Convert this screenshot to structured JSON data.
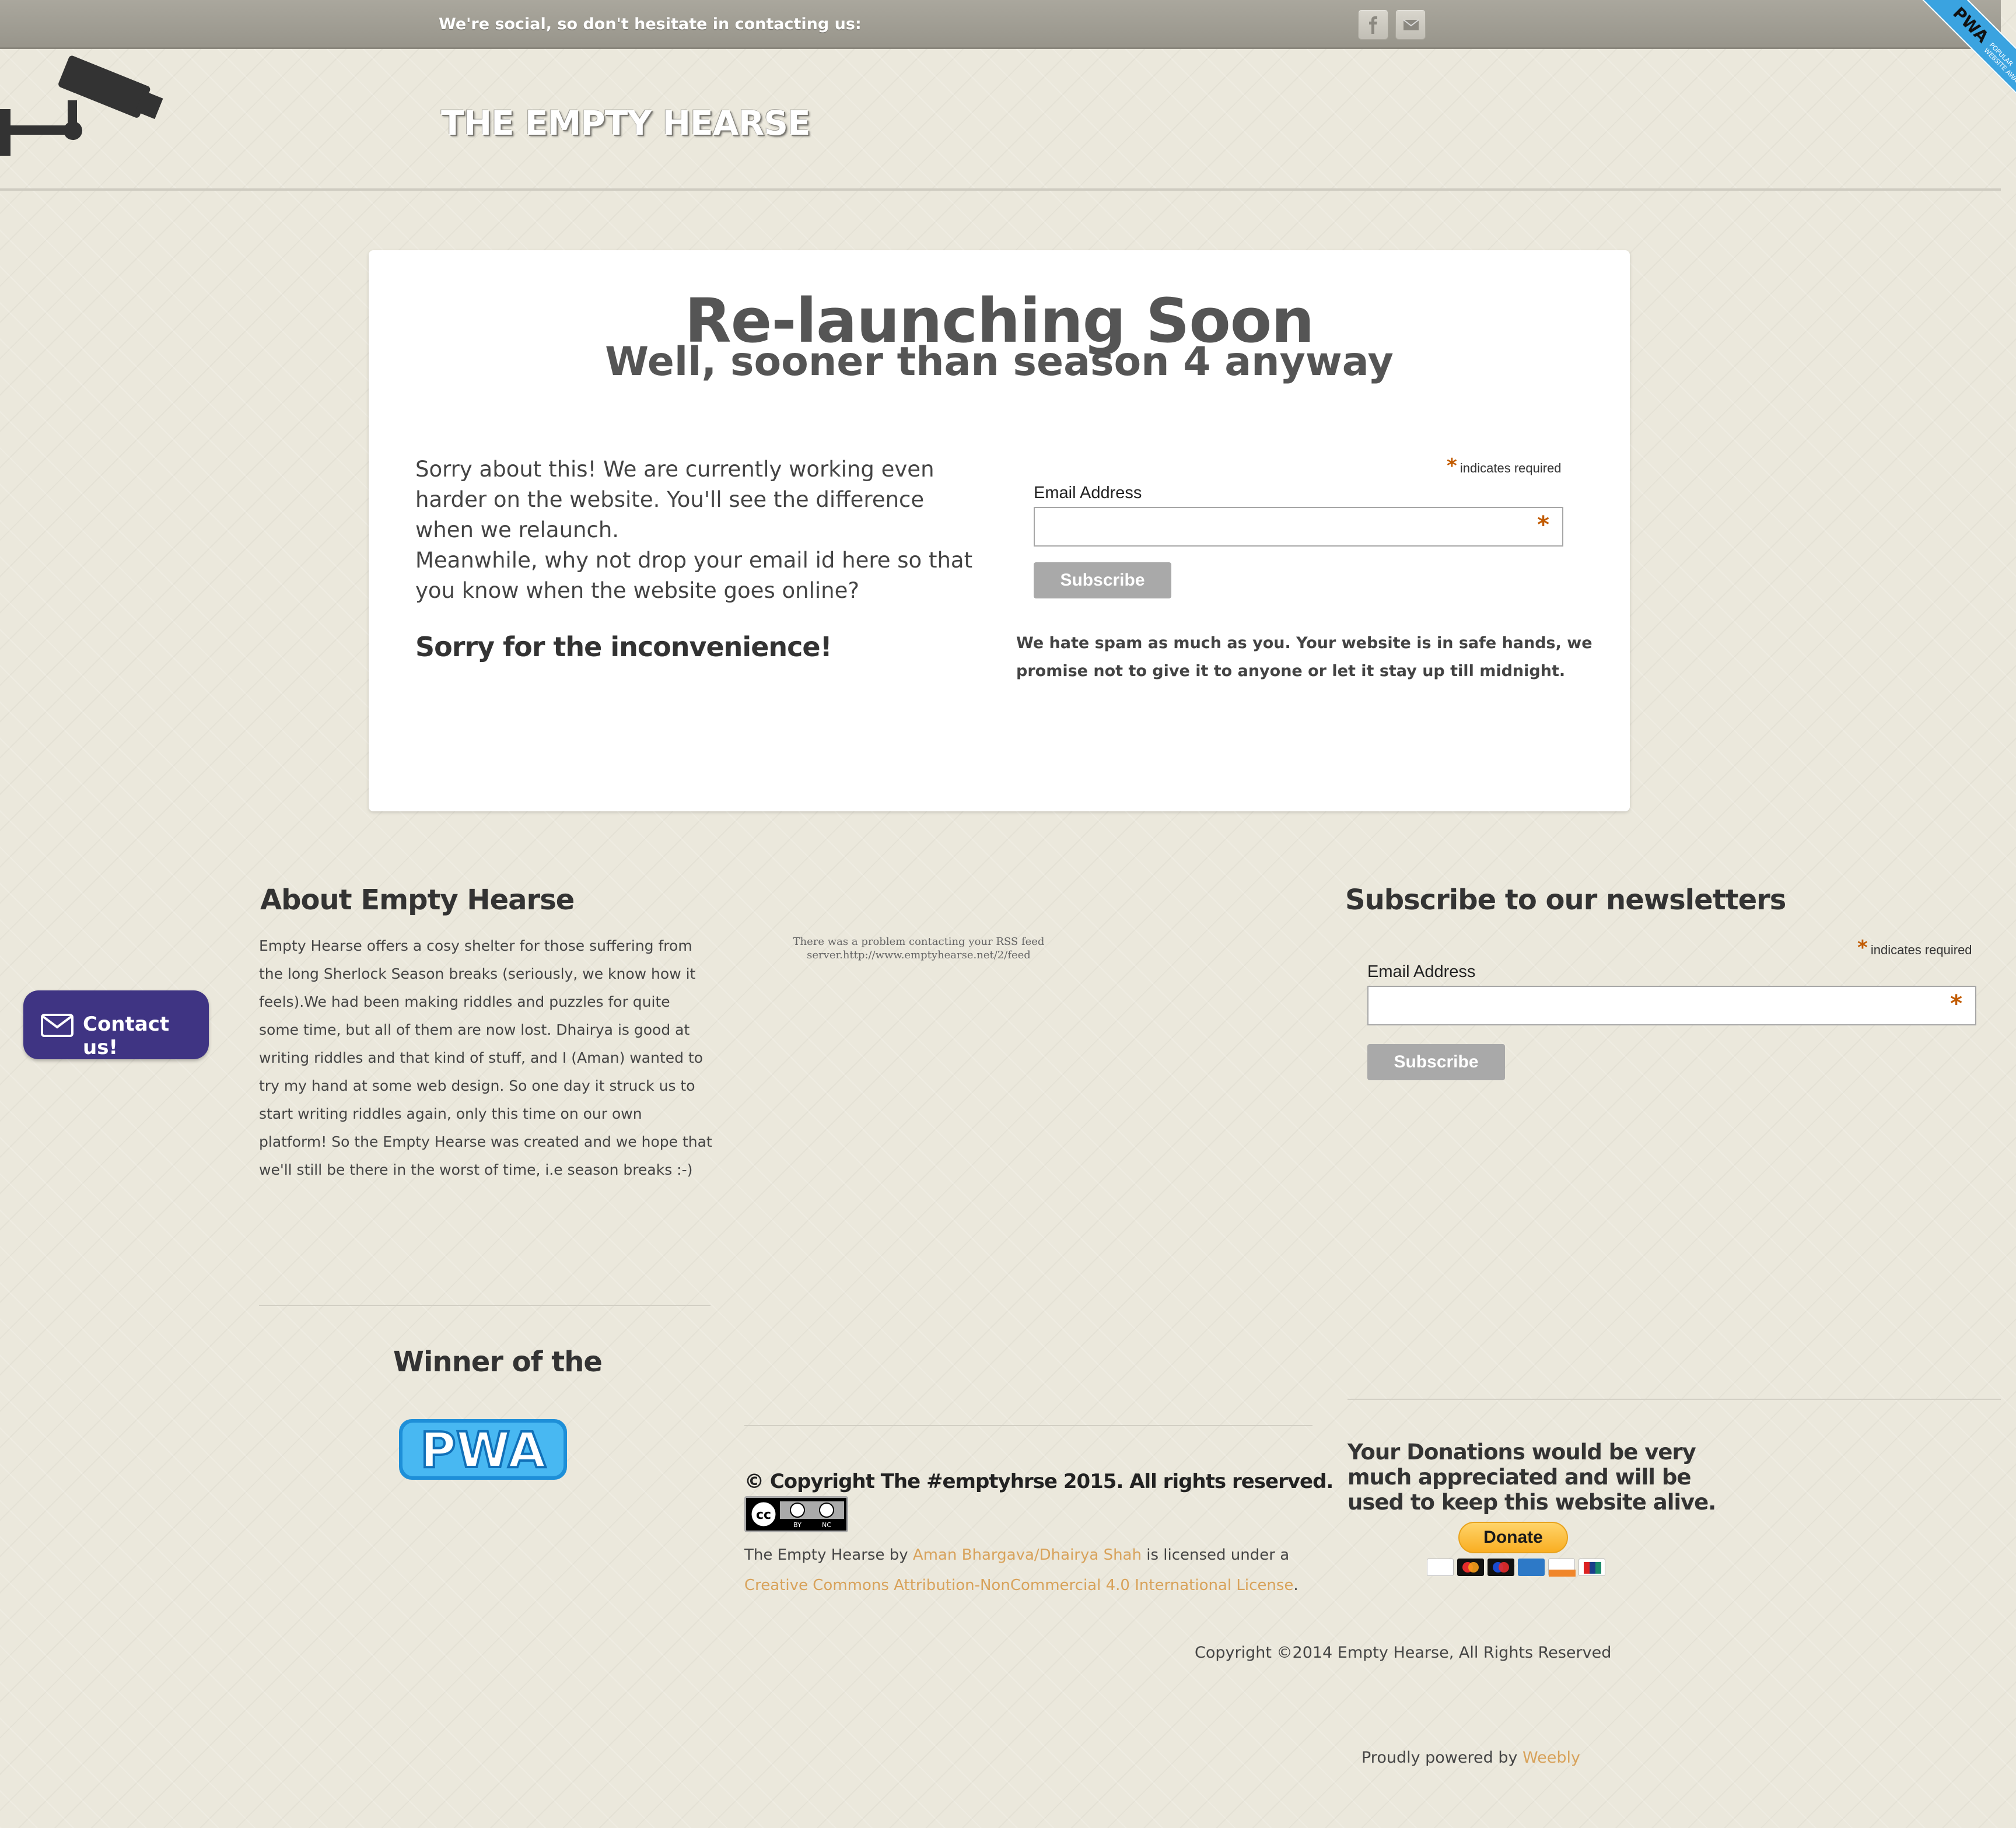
{
  "topbar": {
    "social_text": "We're social, so don't hesitate in contacting us:",
    "icons": [
      "facebook-icon",
      "mail-icon"
    ]
  },
  "header": {
    "site_title": "THE EMPTY HEARSE",
    "logo_icon": "security-camera-icon"
  },
  "ribbon": {
    "big": "PWA",
    "small_line1": "POPULAR",
    "small_line2": "WEBSITE AWARD"
  },
  "card": {
    "title": "Re-launching Soon",
    "subtitle": "Well, sooner than season 4 anyway",
    "paragraph1": "Sorry about this! We are currently working even harder on the website. You'll see the difference when we relaunch.",
    "paragraph2": "Meanwhile, why not drop your email id here so that you know when the website goes online?",
    "sorry": "Sorry for the inconvenience!",
    "form": {
      "required_star": "*",
      "required_note": "indicates required",
      "email_label": "Email Address",
      "email_value": "",
      "input_star": "*",
      "subscribe": "Subscribe"
    },
    "spam_note": "We hate spam as much as you. Your website is in safe hands, we promise not to give it to anyone or let it stay up till midnight."
  },
  "about": {
    "heading": "About Empty Hearse",
    "text": "Empty Hearse offers a cosy shelter for those suffering from the long Sherlock Season breaks (seriously, we know how it feels).We had been making riddles and puzzles for quite some time, but all of them are now lost. Dhairya is good at writing riddles and that kind of stuff, and I (Aman) wanted to try my hand at some web design. So one day it struck us to start writing riddles again, only this time on our own platform! So the Empty Hearse was created and we hope that we'll still be there in the worst of time, i.e season breaks :-)"
  },
  "rss": {
    "error": "There was a problem contacting your RSS feed server.http://www.emptyhearse.net/2/feed"
  },
  "newsletter": {
    "heading": "Subscribe to our newsletters",
    "required_star": "*",
    "required_note": "indicates required",
    "email_label": "Email Address",
    "email_value": "",
    "input_star": "*",
    "subscribe": "Subscribe"
  },
  "contact": {
    "label": "Contact us!",
    "icon": "envelope-icon"
  },
  "winner": {
    "heading": "Winner of the",
    "logo_text": "PWA"
  },
  "license": {
    "copyright": "© Copyright The #emptyhrse  2015. All rights reserved.",
    "cc_by": "BY",
    "cc_nc": "NC",
    "prefix": "The Empty Hearse",
    "by": " by ",
    "author": "Aman Bhargava/Dhairya Shah",
    "mid": " is licensed under a ",
    "license_name": "Creative Commons Attribution-NonCommercial 4.0 International License",
    "suffix": "."
  },
  "donate": {
    "text": "Your Donations would be very much appreciated and will be used to keep this website alive.",
    "button": "Donate",
    "cards": [
      "visa-icon",
      "mastercard-icon",
      "maestro-icon",
      "amex-icon",
      "discover-icon",
      "unionpay-icon"
    ]
  },
  "footer": {
    "copyright": "Copyright ©2014 Empty Hearse, All Rights Reserved",
    "powered_prefix": "Proudly powered by ",
    "powered_link": "Weebly"
  }
}
